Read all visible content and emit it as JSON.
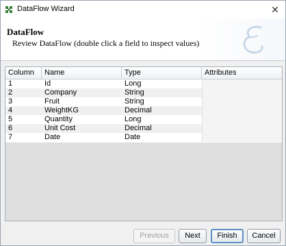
{
  "window": {
    "title": "DataFlow Wizard",
    "close_glyph": "✕"
  },
  "header": {
    "title": "DataFlow",
    "subtitle": "Review DataFlow (double click a field to inspect values)",
    "logo_icon": "script-e-logo"
  },
  "table": {
    "columns": [
      "Column",
      "Name",
      "Type",
      "Attributes"
    ],
    "rows": [
      {
        "column": "1",
        "name": "Id",
        "type": "Long",
        "attributes": ""
      },
      {
        "column": "2",
        "name": "Company",
        "type": "String",
        "attributes": ""
      },
      {
        "column": "3",
        "name": "Fruit",
        "type": "String",
        "attributes": ""
      },
      {
        "column": "4",
        "name": "WeightKG",
        "type": "Decimal",
        "attributes": ""
      },
      {
        "column": "5",
        "name": "Quantity",
        "type": "Long",
        "attributes": ""
      },
      {
        "column": "6",
        "name": "Unit Cost",
        "type": "Decimal",
        "attributes": ""
      },
      {
        "column": "7",
        "name": "Date",
        "type": "Date",
        "attributes": ""
      }
    ]
  },
  "buttons": {
    "previous": "Previous",
    "next": "Next",
    "finish": "Finish",
    "cancel": "Cancel"
  },
  "colors": {
    "accent": "#5a8fc8",
    "grid_empty": "#dedede"
  }
}
